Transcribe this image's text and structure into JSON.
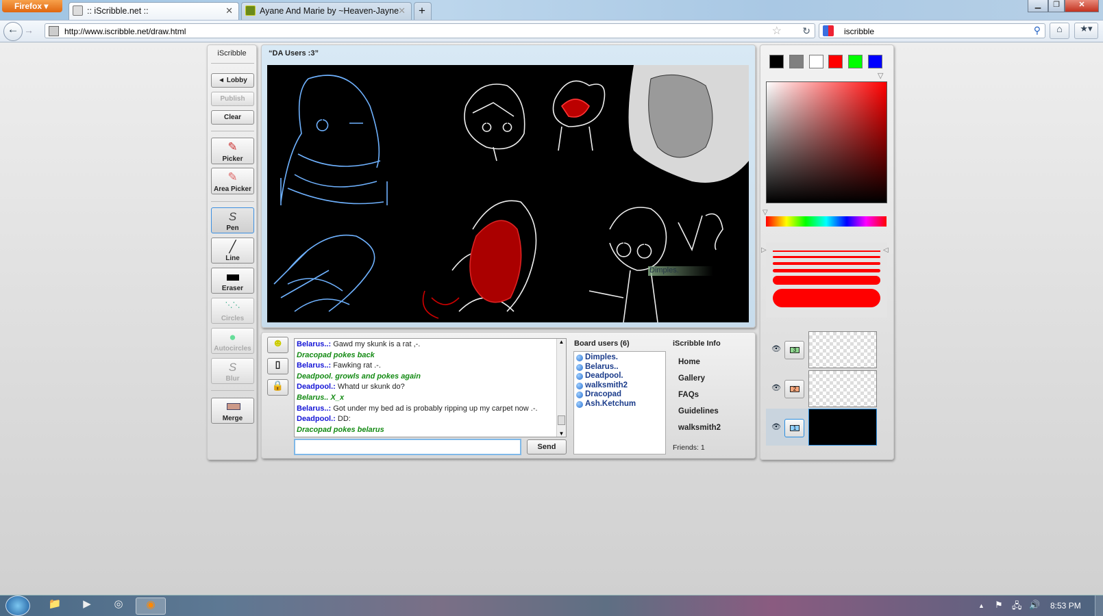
{
  "browser": {
    "app_button": "Firefox",
    "tabs": [
      {
        "title": ":: iScribble.net ::",
        "active": true
      },
      {
        "title": "Ayane And Marie by ~Heaven-Jayne",
        "active": false
      }
    ],
    "url": "http://www.iscribble.net/draw.html",
    "search_value": "iscribble",
    "icons": [
      "back-icon",
      "forward-icon",
      "star-icon",
      "reload-icon",
      "google-icon",
      "search-icon",
      "home-icon",
      "bookmarks-icon"
    ]
  },
  "toolbar": {
    "title": "iScribble",
    "lobby": "◄ Lobby",
    "publish": "Publish",
    "clear": "Clear",
    "tools": [
      {
        "label": "Picker",
        "enabled": true
      },
      {
        "label": "Area Picker",
        "enabled": true
      },
      {
        "label": "Pen",
        "enabled": true,
        "selected": true
      },
      {
        "label": "Line",
        "enabled": true
      },
      {
        "label": "Eraser",
        "enabled": true
      },
      {
        "label": "Circles",
        "enabled": false
      },
      {
        "label": "Autocircles",
        "enabled": false
      },
      {
        "label": "Blur",
        "enabled": false
      }
    ],
    "merge": "Merge"
  },
  "board": {
    "title": "“DA Users  :3”",
    "cursor_tag": "Dimples."
  },
  "chat": {
    "messages": [
      {
        "user": "Belarus..:",
        "text": " Gawd my skunk is a rat ,-.",
        "action": false
      },
      {
        "text": "Dracopad pokes back",
        "action": true
      },
      {
        "user": "Belarus..:",
        "text": " Fawking rat .-.",
        "action": false
      },
      {
        "text": "Deadpool. growls and pokes again",
        "action": true
      },
      {
        "user": "Deadpool.:",
        "text": " Whatd ur skunk do?",
        "action": false
      },
      {
        "text": "Belarus.. X_x",
        "action": true
      },
      {
        "user": "Belarus..:",
        "text": " Got under my bed ad is probably ripping up my carpet now .-.",
        "action": false
      },
      {
        "user": "Deadpool.:",
        "text": " DD:",
        "action": false
      },
      {
        "text": "Dracopad pokes belarus",
        "action": true
      }
    ],
    "input_value": "",
    "send": "Send"
  },
  "users": {
    "title": "Board users (6)",
    "list": [
      "Dimples.",
      "Belarus..",
      "Deadpool.",
      "walksmith2",
      "Dracopad",
      "Ash.Ketchum"
    ]
  },
  "info": {
    "title": "iScribble Info",
    "links": [
      "Home",
      "Gallery",
      "FAQs",
      "Guidelines",
      "walksmith2"
    ],
    "friends": "Friends: 1"
  },
  "palette": {
    "swatches": [
      "#000000",
      "#808080",
      "#ffffff",
      "#ff0000",
      "#00ff00",
      "#0000ff"
    ],
    "current_color": "#ff0000",
    "hue": "red"
  },
  "layers": [
    {
      "number": "3",
      "color": "#8fd88f",
      "visible": true
    },
    {
      "number": "2",
      "color": "#f7a57a",
      "visible": true
    },
    {
      "number": "1",
      "color": "#8fcfff",
      "visible": true,
      "selected": true
    }
  ],
  "taskbar": {
    "clock": "8:53 PM"
  }
}
